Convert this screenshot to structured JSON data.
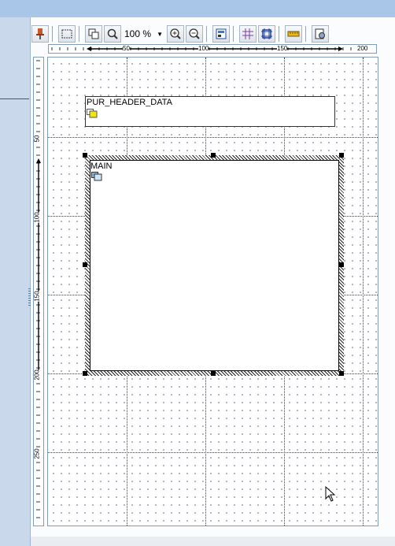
{
  "toolbar": {
    "zoom_value": "100 %",
    "icons": [
      "pin-icon",
      "select-area-icon",
      "copy-windows-icon",
      "zoom-magnifier-icon",
      "zoom-dropdown-arrow",
      "zoom-in-icon",
      "zoom-out-icon",
      "window-layout-icon",
      "grid-icon",
      "grid-align-icon",
      "ruler-icon",
      "settings-icon"
    ]
  },
  "ruler_horizontal": {
    "labels": [
      "50",
      "100",
      "150",
      "200"
    ]
  },
  "ruler_vertical": {
    "labels": [
      "50",
      "100",
      "150",
      "200",
      "250"
    ]
  },
  "windows": {
    "header": {
      "name": "PUR_HEADER_DATA",
      "icon": "secondary-window-icon"
    },
    "main": {
      "name": "MAIN",
      "icon": "main-window-icon"
    }
  },
  "colors": {
    "title_strip": "#a9c6e8",
    "side_panel": "#c9d8ea",
    "ruler_accent": "#000000",
    "header_icon": "#f2e60f",
    "main_icon": "#79b8e8"
  }
}
